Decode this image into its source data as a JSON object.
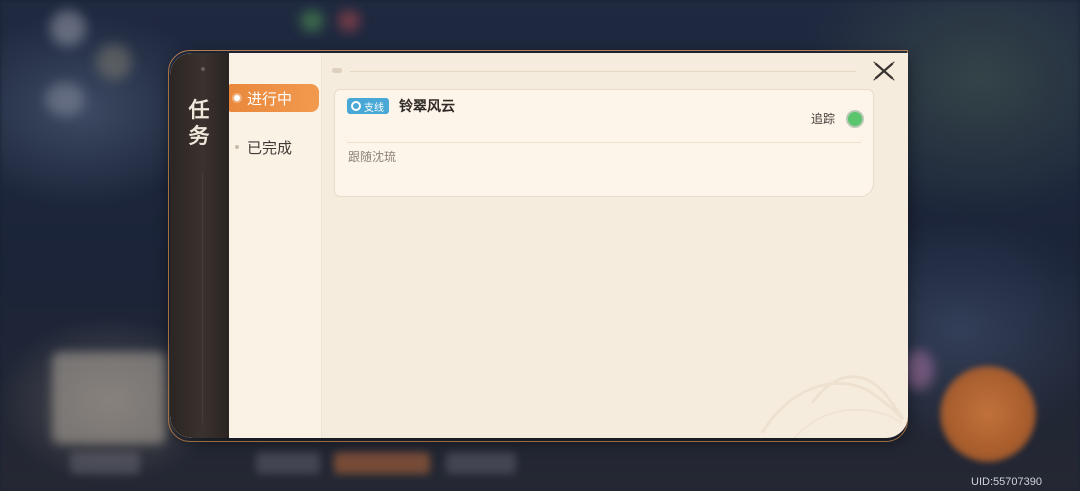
{
  "panel": {
    "title": "任务",
    "tabs": [
      {
        "label": "进行中",
        "active": true
      },
      {
        "label": "已完成",
        "active": false
      }
    ]
  },
  "quest": {
    "badge": "支线",
    "title": "铃翠风云",
    "track_label": "追踪",
    "tracking": true,
    "description": "跟随沈琉"
  },
  "footer": {
    "uid": "UID:55707390"
  },
  "colors": {
    "accent": "#e9883d",
    "badge": "#4aa8d6",
    "track_on": "#5bc46f",
    "panel_bg": "#f6ecde"
  }
}
